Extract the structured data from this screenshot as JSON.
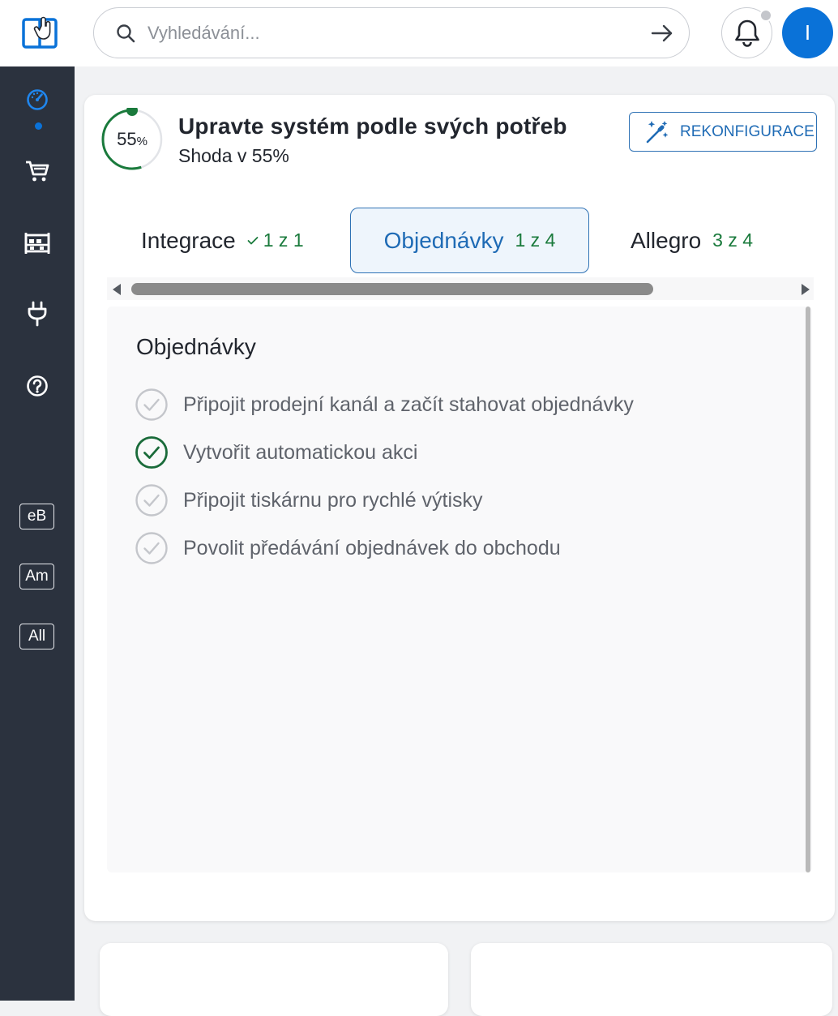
{
  "header": {
    "search_placeholder": "Vyhledávání...",
    "avatar_initial": "I"
  },
  "sidebar": {
    "items": [
      "dashboard-icon",
      "cart-icon",
      "warehouse-icon",
      "plug-icon",
      "help-icon"
    ],
    "marketplaces": [
      "eB",
      "Am",
      "All"
    ]
  },
  "setup": {
    "progress_value": "55",
    "progress_unit": "%",
    "progress_fraction": 0.55,
    "title": "Upravte systém podle svých potřeb",
    "subtitle": "Shoda v 55%",
    "reconfigure_label": "REKONFIGURACE"
  },
  "tabs": [
    {
      "label": "Integrace",
      "count": "1 z 1",
      "complete": true
    },
    {
      "label": "Objednávky",
      "count": "1 z 4",
      "active": true
    },
    {
      "label": "Allegro",
      "count": "3 z 4"
    }
  ],
  "panel": {
    "title": "Objednávky",
    "tasks": [
      {
        "label": "Připojit prodejní kanál a začít stahovat objednávky",
        "done": false
      },
      {
        "label": "Vytvořit automatickou akci",
        "done": true
      },
      {
        "label": "Připojit tiskárnu pro rychlé výtisky",
        "done": false
      },
      {
        "label": "Povolit předávání objednávek do obchodu",
        "done": false
      }
    ]
  },
  "colors": {
    "accent": "#0a72d8",
    "success": "#1a7a3c",
    "sidebar": "#2b323e",
    "muted_check": "#c4c6cb"
  }
}
